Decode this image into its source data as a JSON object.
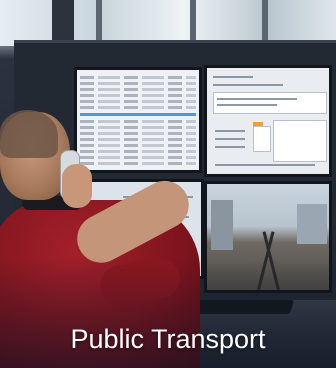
{
  "tile": {
    "caption": "Public Transport"
  }
}
